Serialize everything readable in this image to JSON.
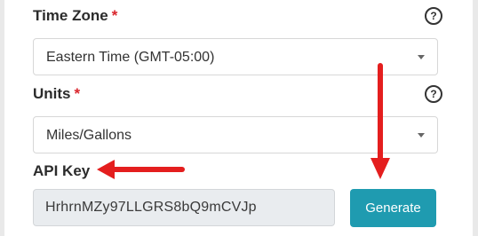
{
  "timezone": {
    "label": "Time Zone",
    "required_mark": "*",
    "value": "Eastern Time (GMT-05:00)",
    "help_symbol": "?"
  },
  "units": {
    "label": "Units",
    "required_mark": "*",
    "value": "Miles/Gallons",
    "help_symbol": "?"
  },
  "api_key": {
    "label": "API Key",
    "value": "HrhrnMZy97LLGRS8bQ9mCVJp",
    "button_label": "Generate"
  },
  "colors": {
    "accent": "#1f9bb0",
    "required": "#d9252c",
    "annotation_arrow": "#e41e1e"
  }
}
